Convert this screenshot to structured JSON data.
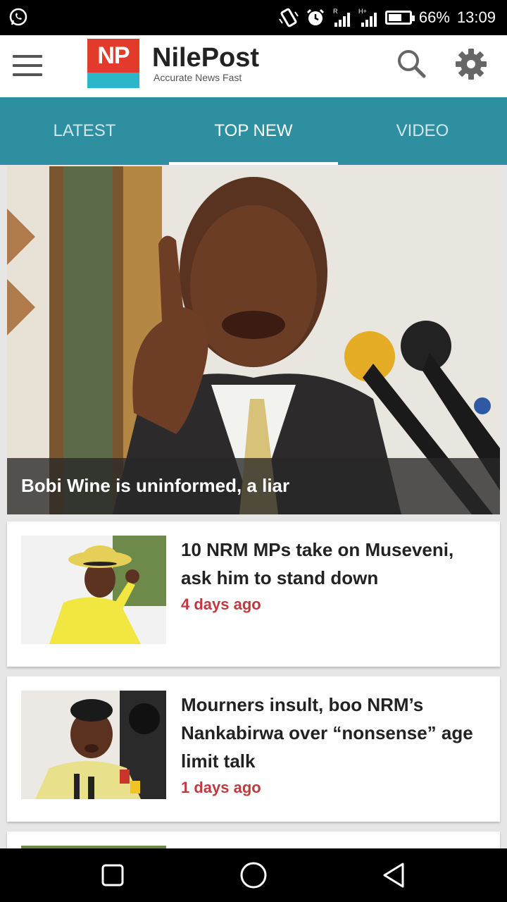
{
  "status_bar": {
    "battery": "66%",
    "time": "13:09",
    "battery_level": 0.66,
    "icons": [
      "whatsapp-icon",
      "vibrate-icon",
      "alarm-icon",
      "signal-icon",
      "signal-icon",
      "battery-icon"
    ]
  },
  "header": {
    "logo_mark": "NP",
    "logo_name": "NilePost",
    "logo_tagline": "Accurate News Fast",
    "icons": [
      "menu-icon",
      "search-icon",
      "gear-icon"
    ]
  },
  "tabs": [
    {
      "label": "LATEST",
      "active": false
    },
    {
      "label": "TOP NEW",
      "active": true
    },
    {
      "label": "VIDEO",
      "active": false
    }
  ],
  "hero": {
    "title": "Bobi Wine is uninformed, a liar"
  },
  "articles": [
    {
      "title": "10 NRM MPs take on Museveni, ask him to stand down",
      "time": "4 days ago"
    },
    {
      "title": "Mourners insult, boo NRM’s Nankabirwa over “nonsense” age limit talk",
      "time": "1 days ago"
    }
  ],
  "colors": {
    "accent": "#2e8fa0",
    "time_text": "#c0393f",
    "logo_red": "#e23b2c",
    "logo_cyan": "#2bb7c7"
  },
  "nav": {
    "icons": [
      "recent-apps-icon",
      "home-icon",
      "back-icon"
    ]
  }
}
